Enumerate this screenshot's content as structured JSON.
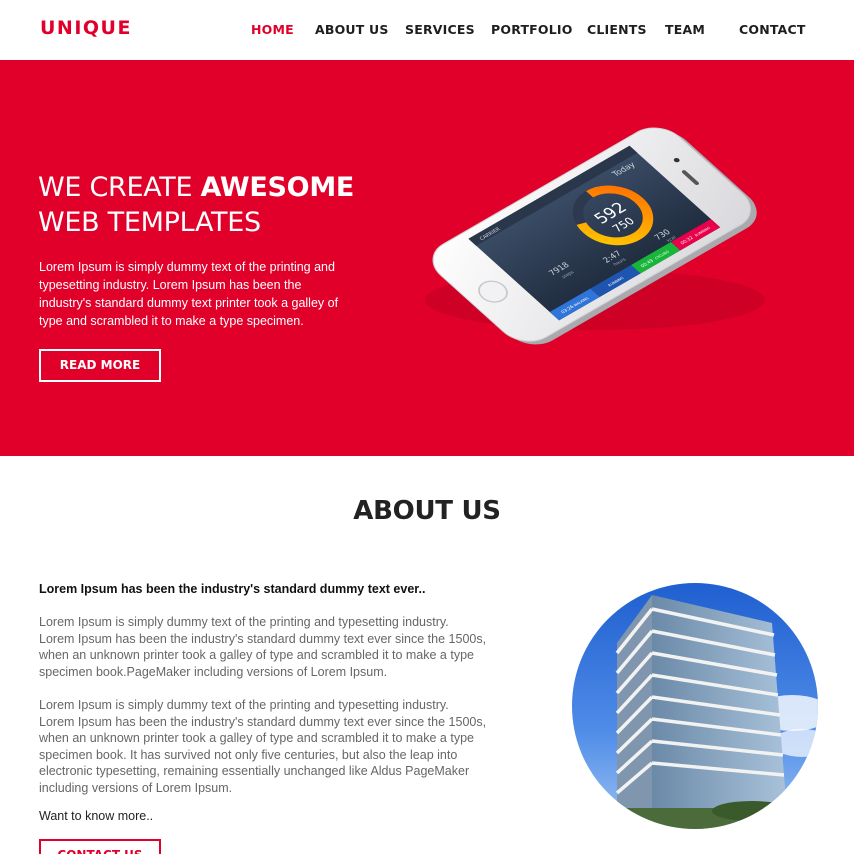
{
  "header": {
    "logo_main": "UNIQU",
    "logo_accent": "E",
    "nav": [
      {
        "label": "HOME",
        "active": true
      },
      {
        "label": "ABOUT US"
      },
      {
        "label": "SERVICES"
      },
      {
        "label": "PORTFOLIO"
      },
      {
        "label": "CLIENTS"
      },
      {
        "label": "TEAM"
      },
      {
        "label": "CONTACT"
      }
    ]
  },
  "hero": {
    "title_line1_light": "WE CREATE ",
    "title_line1_bold": "AWESOME",
    "title_line2": "WEB TEMPLATES",
    "text": "Lorem Ipsum is simply dummy text of the printing and typesetting industry. Lorem Ipsum has been the industry's standard dummy text printer took a galley of type and scrambled it to make a type specimen.",
    "button": "READ MORE",
    "phone_screen": {
      "status": "CARRIER",
      "title": "Today",
      "ring_value": "592",
      "ring_total": "750",
      "stats": [
        {
          "value": "7918",
          "label": "steps"
        },
        {
          "value": "2:47",
          "label": "hours"
        },
        {
          "value": "730",
          "label": "kcal"
        }
      ],
      "tabs": [
        {
          "time": "03:26",
          "label": "WALKING"
        },
        {
          "time": "",
          "label": "RUNNING"
        },
        {
          "time": "00:49",
          "label": "CYCLING"
        },
        {
          "time": "00:32",
          "label": "RUNNING"
        }
      ]
    }
  },
  "about": {
    "title": "ABOUT US",
    "lead": "Lorem Ipsum has been the industry's standard dummy text ever..",
    "p1": "Lorem Ipsum is simply dummy text of the printing and typesetting industry. Lorem Ipsum has been the industry's standard dummy text ever since the 1500s, when an unknown printer took a galley of type and scrambled it to make a type specimen book.PageMaker including versions of Lorem Ipsum.",
    "p2": "Lorem Ipsum is simply dummy text of the printing and typesetting industry. Lorem Ipsum has been the industry's standard dummy text ever since the 1500s, when an unknown printer took a galley of type and scrambled it to make a type specimen book. It has survived not only five centuries, but also the leap into electronic typesetting, remaining essentially unchanged like Aldus PageMaker including versions of Lorem Ipsum.",
    "more": "Want to know more..",
    "button": "CONTACT US"
  },
  "colors": {
    "accent": "#e0002a",
    "text_dark": "#222222",
    "text_muted": "#666666"
  }
}
